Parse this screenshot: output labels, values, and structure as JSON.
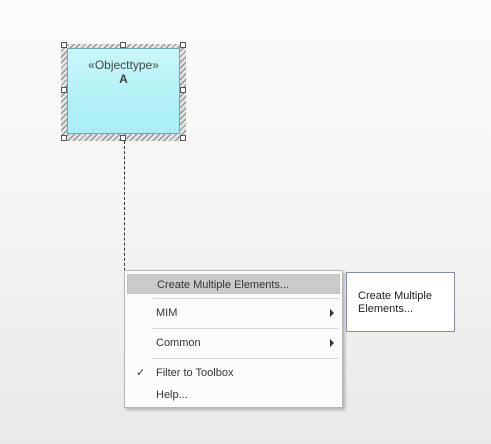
{
  "diagram": {
    "element": {
      "stereotype": "«Objecttype»",
      "name": "A",
      "fill_color": "#b4f2f6"
    }
  },
  "context_menu": {
    "items": [
      {
        "label": "Create Multiple Elements...",
        "highlighted": true
      },
      {
        "label": "MIM",
        "submenu": true
      },
      {
        "label": "Common",
        "submenu": true
      },
      {
        "label": "Filter to Toolbox",
        "checked": true
      },
      {
        "label": "Help..."
      }
    ],
    "check_glyph": "✓"
  },
  "tooltip": {
    "line1": "Create Multiple",
    "line2": "Elements..."
  }
}
